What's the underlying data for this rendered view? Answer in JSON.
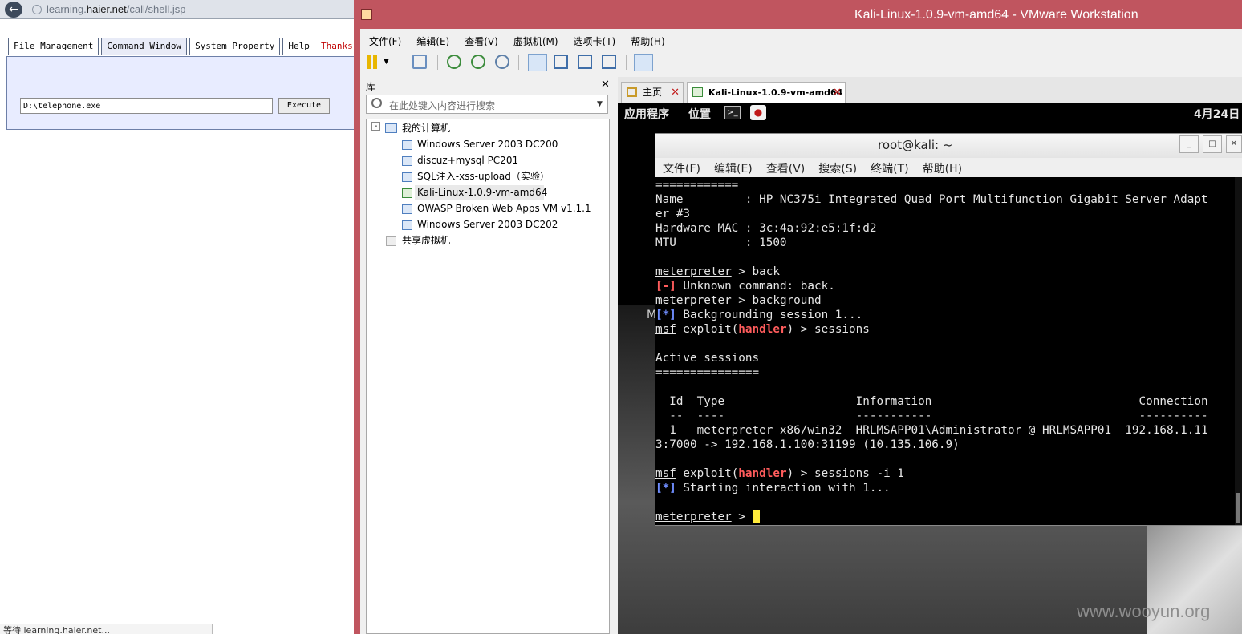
{
  "browser": {
    "url_prefix": "learning.",
    "url_domain": "haier.net",
    "url_path": "/call/shell.jsp",
    "tabs": [
      "File Management",
      "Command Window",
      "System Property",
      "Help"
    ],
    "thanks": "Thanks",
    "command_value": "D:\\telephone.exe",
    "execute_label": "Execute",
    "status": "等待 learning.haier.net..."
  },
  "vmware": {
    "title": "Kali-Linux-1.0.9-vm-amd64 - VMware Workstation",
    "menu": [
      "文件(F)",
      "编辑(E)",
      "查看(V)",
      "虚拟机(M)",
      "选项卡(T)",
      "帮助(H)"
    ],
    "library": {
      "label": "库",
      "search_placeholder": "在此处键入内容进行搜索",
      "root": "我的计算机",
      "vms": [
        "Windows Server 2003 DC200",
        "discuz+mysql PC201",
        "SQL注入-xss-upload（实验）",
        "Kali-Linux-1.0.9-vm-amd64",
        "OWASP Broken Web Apps VM v1.1.1",
        "Windows Server 2003 DC202"
      ],
      "shared": "共享虚拟机"
    },
    "tabs": [
      "主页",
      "Kali-Linux-1.0.9-vm-amd64"
    ]
  },
  "guest": {
    "panel_apps": "应用程序",
    "panel_places": "位置",
    "date": "4月24日",
    "desktop_label": "M",
    "watermark": "www.wooyun.org"
  },
  "terminal": {
    "title": "root@kali: ~",
    "menu": [
      "文件(F)",
      "编辑(E)",
      "查看(V)",
      "搜索(S)",
      "终端(T)",
      "帮助(H)"
    ],
    "lines": {
      "l01": "============",
      "l02": "Name         : HP NC375i Integrated Quad Port Multifunction Gigabit Server Adapt",
      "l03": "er #3",
      "l04": "Hardware MAC : 3c:4a:92:e5:1f:d2",
      "l05": "MTU          : 1500",
      "l07a": "meterpreter",
      "l07b": " > back",
      "l08a": "[-]",
      "l08b": " Unknown command: back.",
      "l09a": "meterpreter",
      "l09b": " > background",
      "l10a": "[*]",
      "l10b": " Backgrounding session 1...",
      "l11a": "msf",
      "l11b": " exploit(",
      "l11c": "handler",
      "l11d": ") > sessions",
      "l13": "Active sessions",
      "l14": "===============",
      "l16": "  Id  Type                   Information                              Connection",
      "l17": "  --  ----                   -----------                              ----------",
      "l18": "  1   meterpreter x86/win32  HRLMSAPP01\\Administrator @ HRLMSAPP01  192.168.1.11",
      "l19": "3:7000 -> 192.168.1.100:31199 (10.135.106.9)",
      "l21a": "msf",
      "l21b": " exploit(",
      "l21c": "handler",
      "l21d": ") > sessions -i 1",
      "l22a": "[*]",
      "l22b": " Starting interaction with 1...",
      "l24a": "meterpreter",
      "l24b": " > "
    }
  }
}
